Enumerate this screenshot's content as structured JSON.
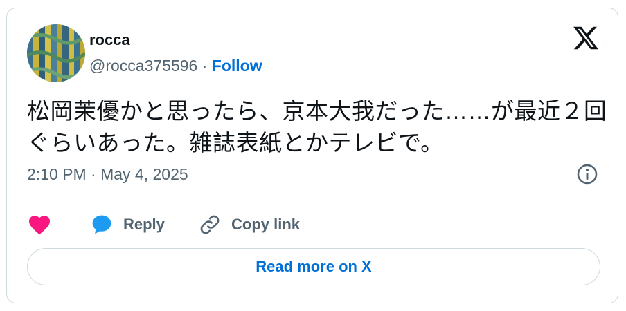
{
  "author": {
    "display_name": "rocca",
    "handle": "@rocca375596",
    "separator": "·",
    "follow_label": "Follow",
    "avatar_icon": "avatar-image"
  },
  "brand": {
    "logo_icon": "x-logo-icon"
  },
  "tweet": {
    "text": "松岡茉優かと思ったら、京本大我だった……が最近２回ぐらいあった。雑誌表紙とかテレビで。",
    "timestamp": "2:10 PM · May 4, 2025"
  },
  "actions": {
    "like_icon": "heart-icon",
    "reply_label": "Reply",
    "reply_icon": "speech-bubble-icon",
    "copy_label": "Copy link",
    "copy_icon": "link-icon",
    "info_icon": "info-icon"
  },
  "footer": {
    "read_more_label": "Read more on X"
  },
  "colors": {
    "text": "#0f1419",
    "secondary": "#536471",
    "link": "#006fd6",
    "like": "#f91880",
    "reply": "#1d9bf0",
    "border": "#cfd9de"
  }
}
